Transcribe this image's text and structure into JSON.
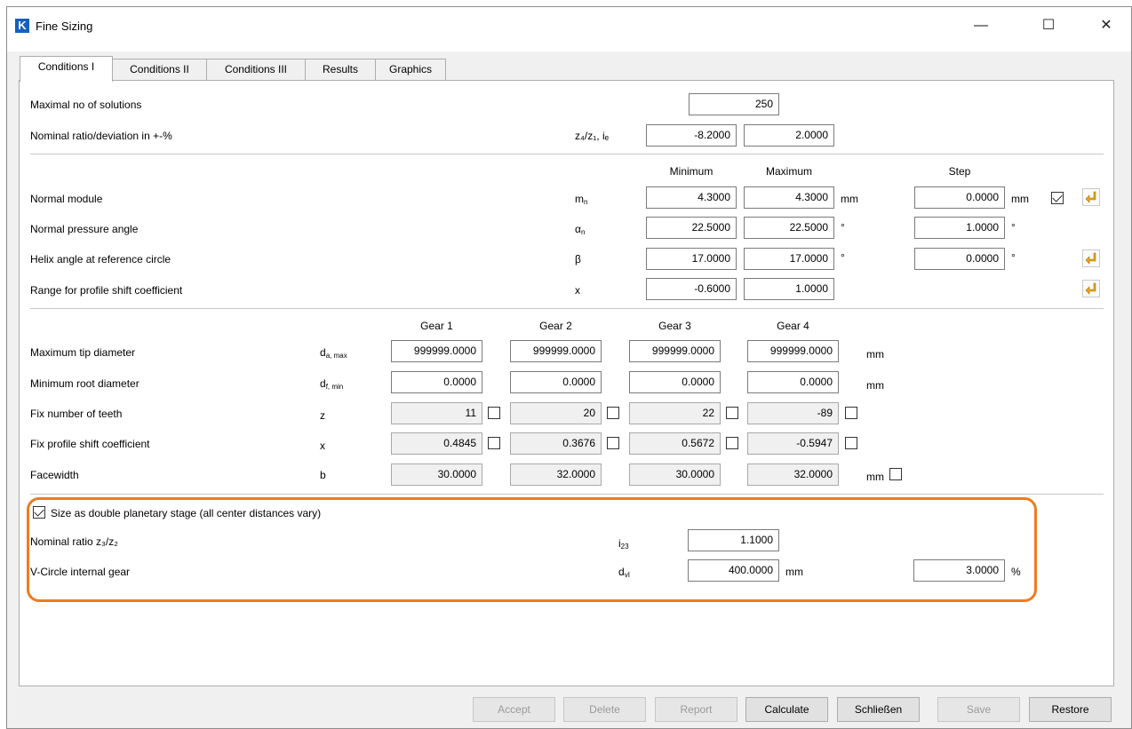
{
  "window": {
    "title": "Fine Sizing",
    "app_icon_letter": "K",
    "minimize": "—",
    "maximize": "☐",
    "close": "✕"
  },
  "tabs": [
    "Conditions I",
    "Conditions II",
    "Conditions III",
    "Results",
    "Graphics"
  ],
  "section1": {
    "max_solutions_label": "Maximal no of solutions",
    "max_solutions_value": "250",
    "nominal_ratio_label": "Nominal ratio/deviation in +-%",
    "nominal_ratio_symbol": "z₄/z₁, iₑ",
    "nominal_ratio_value": "-8.2000",
    "nominal_deviation_value": "2.0000"
  },
  "section2": {
    "headers": {
      "minimum": "Minimum",
      "maximum": "Maximum",
      "step": "Step"
    },
    "rows": [
      {
        "label": "Normal module",
        "symbol": "m",
        "sub": "n",
        "min": "4.3000",
        "max": "4.3000",
        "unit": "mm",
        "step": "0.0000",
        "step_unit": "mm",
        "checked": true
      },
      {
        "label": "Normal pressure angle",
        "symbol": "α",
        "sub": "n",
        "min": "22.5000",
        "max": "22.5000",
        "unit": "°",
        "step": "1.0000",
        "step_unit": "°"
      },
      {
        "label": "Helix angle at reference circle",
        "symbol": "β",
        "sub": "",
        "min": "17.0000",
        "max": "17.0000",
        "unit": "°",
        "step": "0.0000",
        "step_unit": "°"
      },
      {
        "label": "Range for profile shift coefficient",
        "symbol": "x",
        "sub": "",
        "min": "-0.6000",
        "max": "1.0000"
      }
    ]
  },
  "section3": {
    "headers": [
      "Gear 1",
      "Gear 2",
      "Gear 3",
      "Gear 4"
    ],
    "rows": [
      {
        "label": "Maximum tip diameter",
        "symbol": "d",
        "sub": "a, max",
        "values": [
          "999999.0000",
          "999999.0000",
          "999999.0000",
          "999999.0000"
        ],
        "unit": "mm"
      },
      {
        "label": "Minimum root diameter",
        "symbol": "d",
        "sub": "f, min",
        "values": [
          "0.0000",
          "0.0000",
          "0.0000",
          "0.0000"
        ],
        "unit": "mm"
      },
      {
        "label": "Fix number of teeth",
        "symbol": "z",
        "sub": "",
        "values": [
          "11",
          "20",
          "22",
          "-89"
        ]
      },
      {
        "label": "Fix profile shift coefficient",
        "symbol": "x",
        "sub": "",
        "values": [
          "0.4845",
          "0.3676",
          "0.5672",
          "-0.5947"
        ]
      },
      {
        "label": "Facewidth",
        "symbol": "b",
        "sub": "",
        "values": [
          "30.0000",
          "32.0000",
          "30.0000",
          "32.0000"
        ],
        "unit": "mm"
      }
    ]
  },
  "section4": {
    "double_planetary_label": "Size as double planetary stage (all center distances vary)",
    "double_planetary_checked": true,
    "nominal_ratio_label": "Nominal ratio z₃/z₂",
    "nominal_ratio_symbol": "i",
    "nominal_ratio_sub": "23",
    "nominal_ratio_value": "1.1000",
    "vcircle_label": "V-Circle internal gear",
    "vcircle_symbol": "d",
    "vcircle_sub": "vI",
    "vcircle_value": "400.0000",
    "vcircle_unit": "mm",
    "vcircle_pct_value": "3.0000",
    "vcircle_pct_unit": "%"
  },
  "buttons": {
    "accept": "Accept",
    "delete": "Delete",
    "report": "Report",
    "calculate": "Calculate",
    "close": "Schließen",
    "save": "Save",
    "restore": "Restore"
  },
  "colors": {
    "highlight": "#f07b1e",
    "arrow_icon": "#e6a817",
    "app_icon": "#1560bd"
  }
}
